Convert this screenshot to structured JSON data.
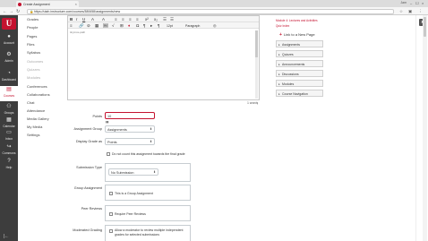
{
  "browser": {
    "tab_title": "Create Assignment",
    "tab_close": "×",
    "user": "Jam",
    "url": "https://utah.instructure.com/courses/380658/assignments/new",
    "controls": {
      "minimize": "–",
      "maximize": "☐",
      "close": "×"
    }
  },
  "global_nav": {
    "logo_text": "U",
    "items": [
      {
        "label": "Account",
        "icon": "account-icon"
      },
      {
        "label": "Admin",
        "icon": "admin-icon"
      },
      {
        "label": "Dashboard",
        "icon": "dashboard-icon"
      },
      {
        "label": "Courses",
        "icon": "courses-icon"
      },
      {
        "label": "Groups",
        "icon": "groups-icon"
      },
      {
        "label": "Calendar",
        "icon": "calendar-icon"
      },
      {
        "label": "Inbox",
        "icon": "inbox-icon"
      },
      {
        "label": "Commons",
        "icon": "commons-icon"
      },
      {
        "label": "Help",
        "icon": "help-icon"
      }
    ],
    "collapse_glyph": "|←"
  },
  "course_nav": [
    {
      "label": "Grades",
      "dim": false
    },
    {
      "label": "People",
      "dim": false
    },
    {
      "label": "Pages",
      "dim": false
    },
    {
      "label": "Files",
      "dim": false
    },
    {
      "label": "Syllabus",
      "dim": false
    },
    {
      "label": "Outcomes",
      "dim": true
    },
    {
      "label": "Quizzes",
      "dim": true
    },
    {
      "label": "Modules",
      "dim": true
    },
    {
      "label": "Conferences",
      "dim": false
    },
    {
      "label": "Collaborations",
      "dim": false
    },
    {
      "label": "Chat",
      "dim": false
    },
    {
      "label": "Attendance",
      "dim": false
    },
    {
      "label": "Media Gallery",
      "dim": false
    },
    {
      "label": "My Media",
      "dim": false
    },
    {
      "label": "Settings",
      "dim": false
    }
  ],
  "editor": {
    "row1": [
      "B",
      "I",
      "U",
      "A",
      "A",
      "≡",
      "≡",
      "≡",
      "≡",
      "x²",
      "x₂",
      "☰",
      "☰"
    ],
    "row2": [
      "≡",
      "🔗",
      "⊘",
      "▦",
      "🖼",
      "√",
      "⊞",
      "♦",
      "Ω",
      "¶",
      "▸",
      "¶"
    ],
    "font_size": "12pt",
    "format": "Paragraph",
    "path": "tinymce-path",
    "word_count": "1 words"
  },
  "form": {
    "points_label": "Points",
    "points_value": "10",
    "points_hint": "▮▮",
    "assignment_group_label": "Assignment Group",
    "assignment_group_value": "Assignments",
    "display_grade_label": "Display Grade as",
    "display_grade_value": "Points",
    "dont_count_label": "Do not count this assignment towards the final grade",
    "submission_type_label": "Submission Type",
    "submission_type_value": "No Submission",
    "group_assignment_label": "Group Assignment",
    "group_assignment_check": "This is a Group Assignment",
    "peer_reviews_label": "Peer Reviews",
    "peer_reviews_check": "Require Peer Reviews",
    "moderated_grading_label": "Moderated Grading",
    "moderated_line1": "Allow a moderator to review multiple independent",
    "moderated_line2": "grades for selected submissions"
  },
  "right_sidebar": {
    "links": [
      "Module 4: Lectures and Activities",
      "Quiz Index"
    ],
    "new_page": "Link to a New Page",
    "sections": [
      "Assignments",
      "Quizzes",
      "Announcements",
      "Discussions",
      "Modules",
      "Course Navigation"
    ]
  },
  "colors": {
    "brand": "#c4122f",
    "nav_bg": "#3d3d3d"
  }
}
